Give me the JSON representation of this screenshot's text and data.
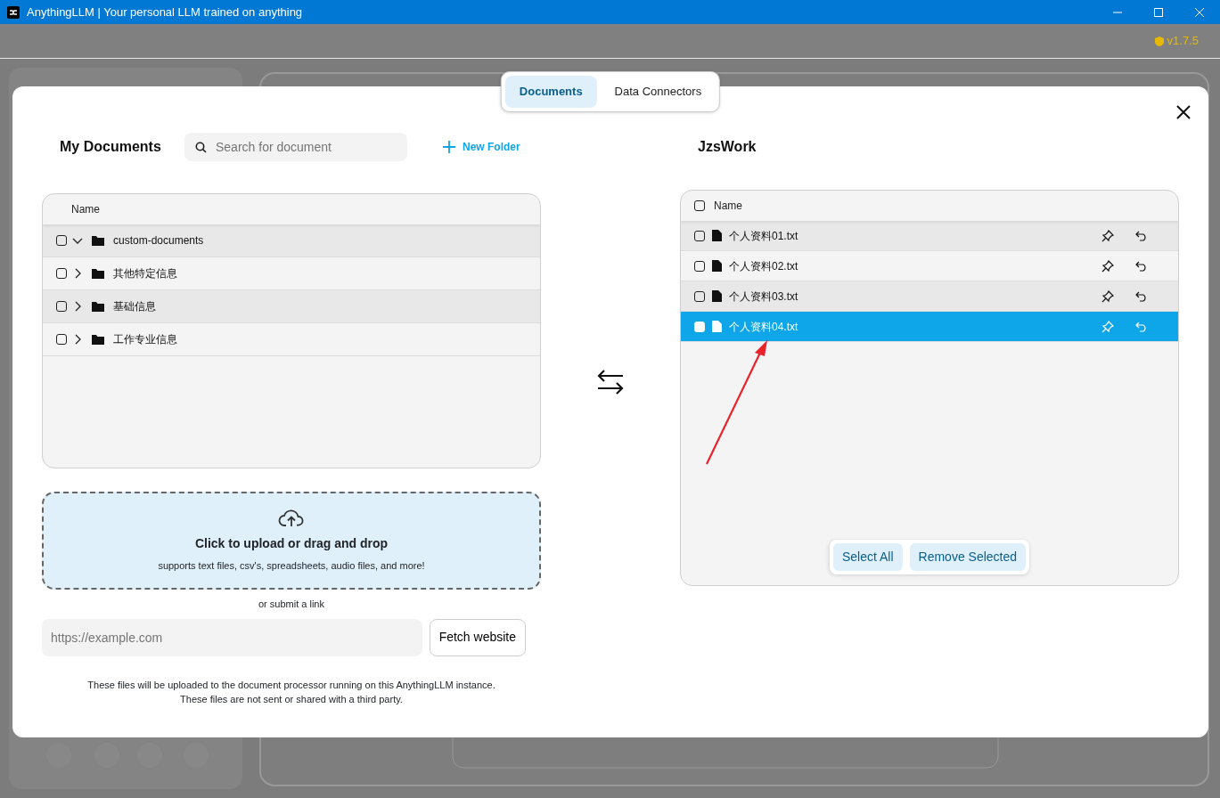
{
  "window": {
    "title": "AnythingLLM | Your personal LLM trained on anything"
  },
  "app_bar": {
    "version": "v1.7.5"
  },
  "modal_tabs": [
    {
      "label": "Documents",
      "selected": true
    },
    {
      "label": "Data Connectors",
      "selected": false
    }
  ],
  "my_documents": {
    "title": "My Documents",
    "search": {
      "placeholder": "Search for document"
    },
    "new_folder": "New Folder",
    "table": {
      "column": "Name",
      "folders": [
        {
          "name": "custom-documents",
          "expanded": true,
          "checked": false
        },
        {
          "name": "其他特定信息",
          "expanded": false,
          "checked": false
        },
        {
          "name": "基础信息",
          "expanded": false,
          "checked": false
        },
        {
          "name": "工作专业信息",
          "expanded": false,
          "checked": false
        }
      ]
    }
  },
  "upload": {
    "title": "Click to upload or drag and drop",
    "subtitle": "supports text files, csv's, spreadsheets, audio files, and more!",
    "link_label": "or submit a link",
    "url": {
      "placeholder": "https://example.com"
    },
    "fetch_button": "Fetch website",
    "notice": [
      "These files will be uploaded to the document processor running on this AnythingLLM instance.",
      "These files are not sent or shared with a third party."
    ]
  },
  "workspace": {
    "title": "JzsWork",
    "table": {
      "column": "Name",
      "all_checked": false,
      "files": [
        {
          "name": "个人资料01.txt",
          "checked": false,
          "selected": false
        },
        {
          "name": "个人资料02.txt",
          "checked": false,
          "selected": false
        },
        {
          "name": "个人资料03.txt",
          "checked": false,
          "selected": false
        },
        {
          "name": "个人资料04.txt",
          "checked": false,
          "selected": true
        }
      ]
    },
    "actions": [
      "Select All",
      "Remove Selected"
    ]
  }
}
